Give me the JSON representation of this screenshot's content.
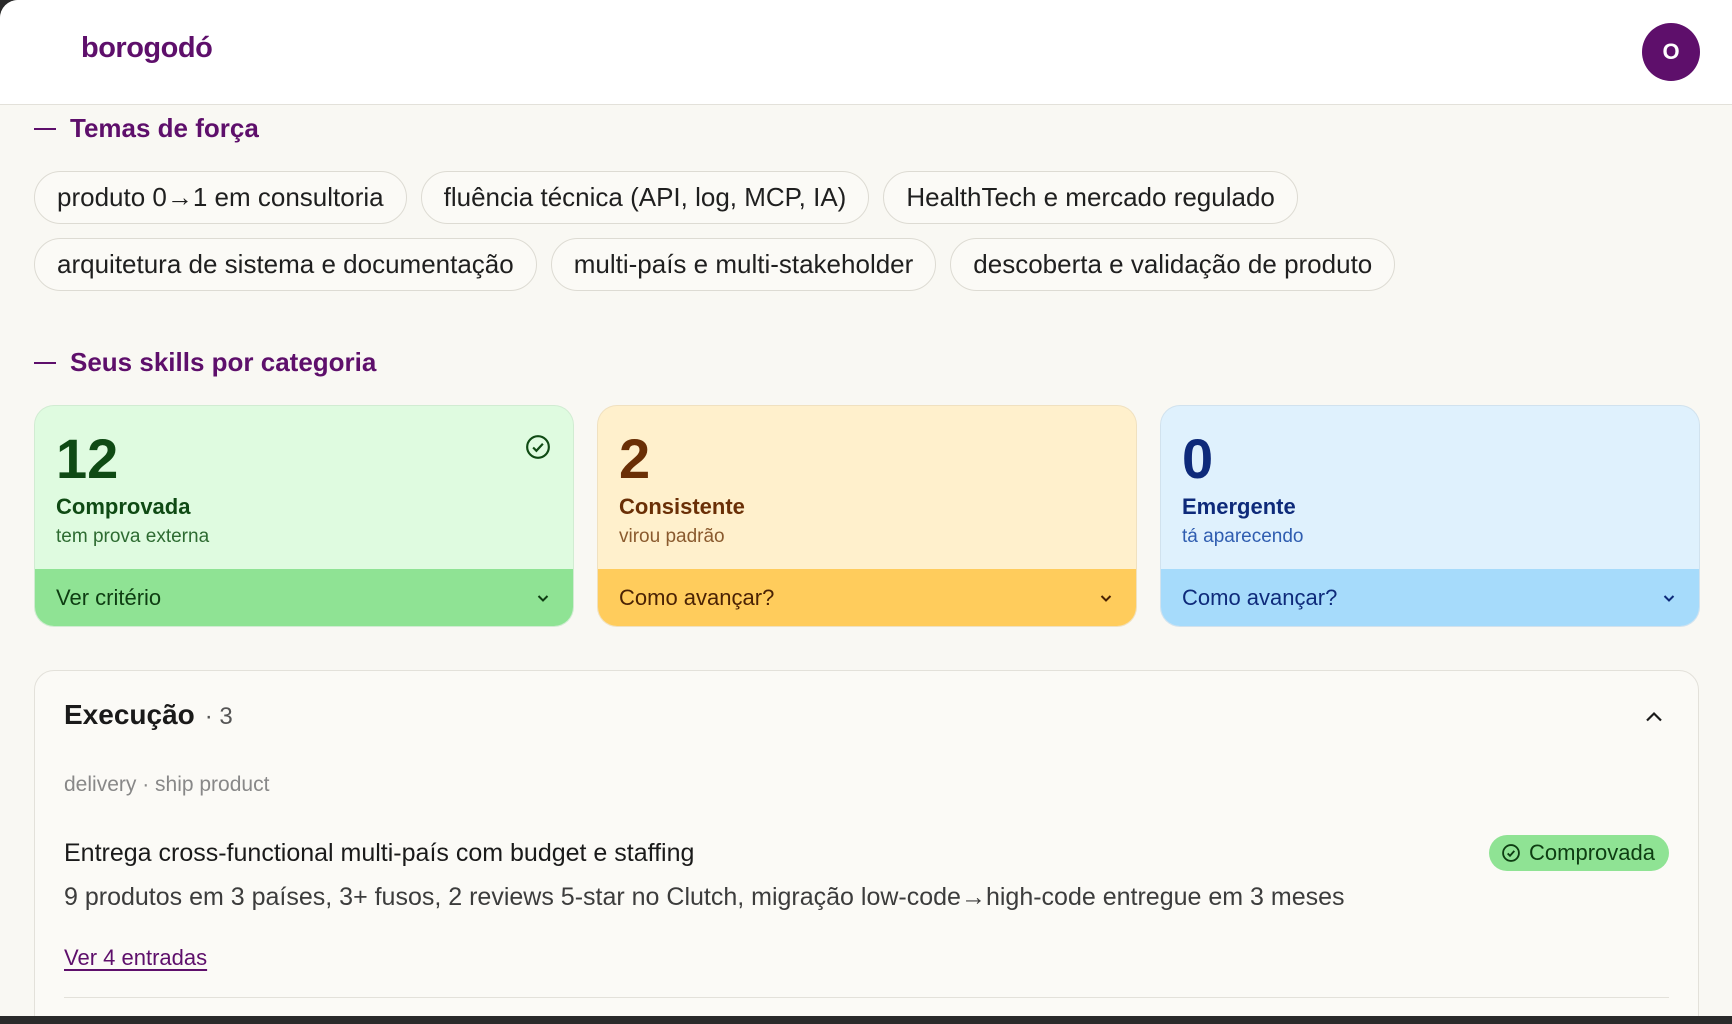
{
  "header": {
    "logo": "borogodó",
    "avatar_initial": "O"
  },
  "strengths": {
    "title": "Temas de força",
    "chips": [
      "produto 0→1 em consultoria",
      "fluência técnica (API, log, MCP, IA)",
      "HealthTech e mercado regulado",
      "arquitetura de sistema e documentação",
      "multi-país e multi-stakeholder",
      "descoberta e validação de produto"
    ]
  },
  "skills": {
    "title": "Seus skills por categoria",
    "cards": [
      {
        "count": "12",
        "label": "Comprovada",
        "sub": "tem prova externa",
        "action": "Ver critério",
        "color": "#8fe394"
      },
      {
        "count": "2",
        "label": "Consistente",
        "sub": "virou padrão",
        "action": "Como avançar?",
        "color": "#ffcc5c"
      },
      {
        "count": "0",
        "label": "Emergente",
        "sub": "tá aparecendo",
        "action": "Como avançar?",
        "color": "#a6dbfb"
      }
    ]
  },
  "category": {
    "title": "Execução",
    "count": "· 3",
    "tags": "delivery · ship product",
    "items": [
      {
        "title": "Entrega cross-functional multi-país com budget e staffing",
        "badge": "Comprovada",
        "description": "9 produtos em 3 países, 3+ fusos, 2 reviews 5-star no Clutch, migração low-code→high-code entregue em 3 meses",
        "link": "Ver 4 entradas"
      }
    ]
  }
}
